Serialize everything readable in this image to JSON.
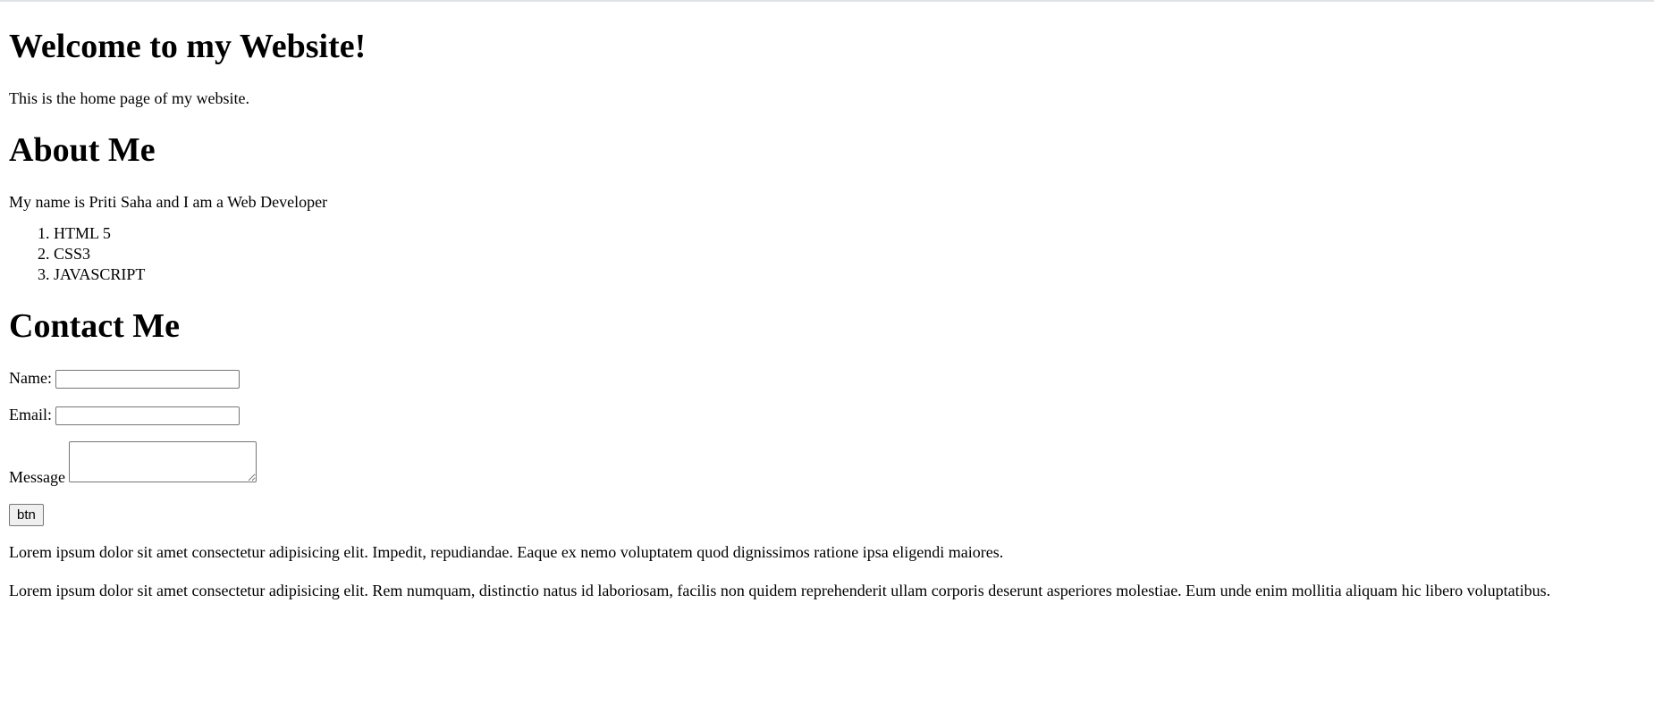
{
  "header": {
    "title": "Welcome to my Website!",
    "intro": "This is the home page of my website."
  },
  "about": {
    "heading": "About Me",
    "text": "My name is Priti Saha and I am a Web Developer",
    "skills": [
      "HTML 5",
      "CSS3",
      "JAVASCRIPT"
    ]
  },
  "contact": {
    "heading": "Contact Me",
    "name_label": "Name:",
    "name_value": "",
    "email_label": "Email:",
    "email_value": "",
    "message_label": "Message",
    "message_value": "",
    "button_label": "btn"
  },
  "paragraphs": [
    "Lorem ipsum dolor sit amet consectetur adipisicing elit. Impedit, repudiandae. Eaque ex nemo voluptatem quod dignissimos ratione ipsa eligendi maiores.",
    "Lorem ipsum dolor sit amet consectetur adipisicing elit. Rem numquam, distinctio natus id laboriosam, facilis non quidem reprehenderit ullam corporis deserunt asperiores molestiae. Eum unde enim mollitia aliquam hic libero voluptatibus."
  ]
}
